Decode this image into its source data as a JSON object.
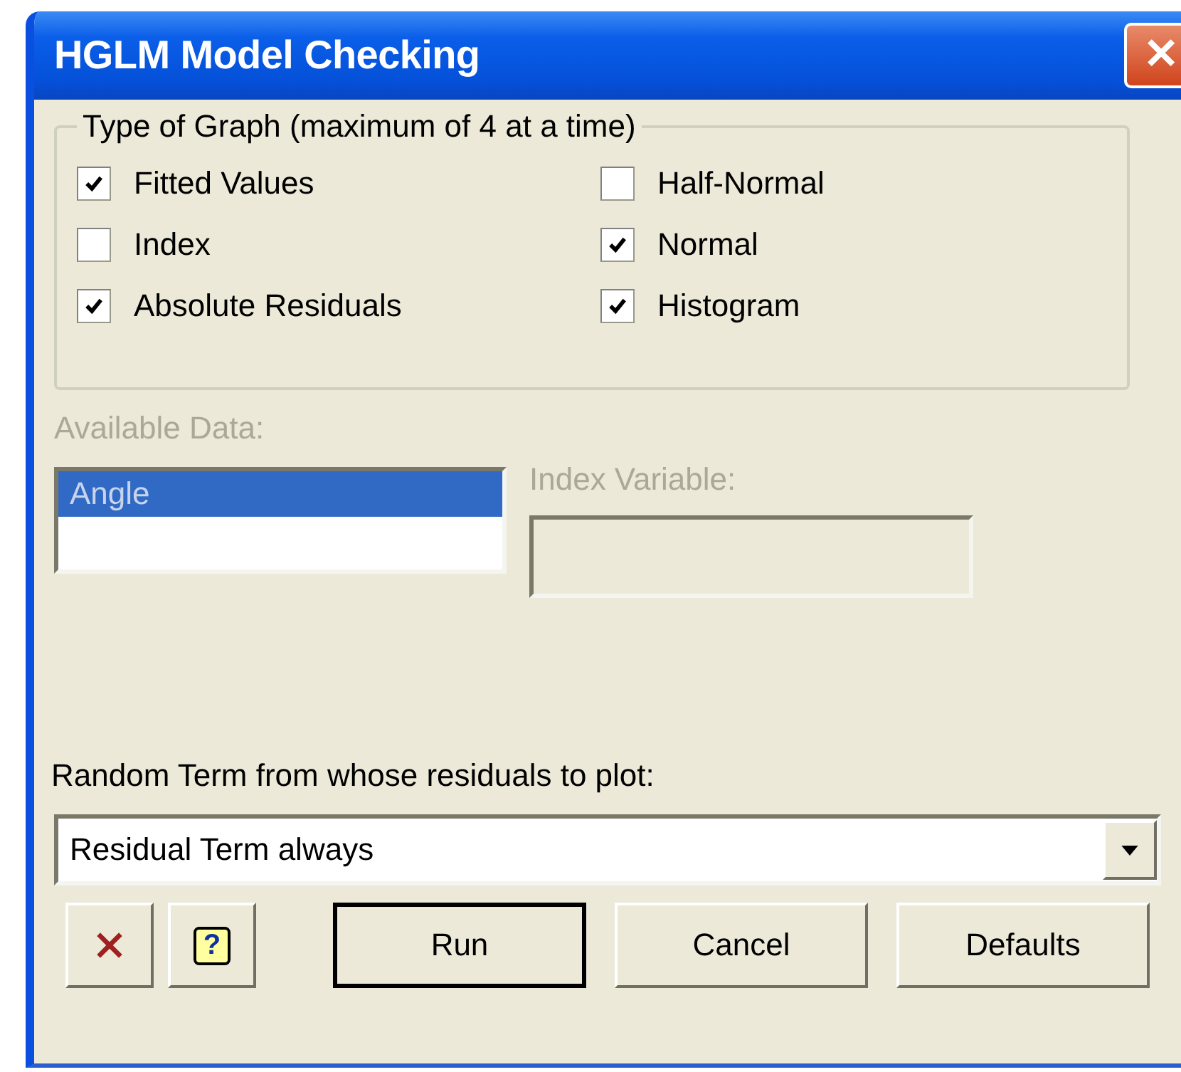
{
  "window": {
    "title": "HGLM Model Checking",
    "close_label": "✕"
  },
  "graph_types": {
    "legend": "Type of Graph (maximum of 4 at a time)",
    "options": [
      {
        "label": "Fitted Values",
        "checked": true
      },
      {
        "label": "Half-Normal",
        "checked": false
      },
      {
        "label": "Index",
        "checked": false
      },
      {
        "label": "Normal",
        "checked": true
      },
      {
        "label": "Absolute Residuals",
        "checked": true
      },
      {
        "label": "Histogram",
        "checked": true
      }
    ]
  },
  "available_data": {
    "label": "Available Data:",
    "disabled": true,
    "items": [
      {
        "label": "Angle",
        "selected": true
      }
    ]
  },
  "index_variable": {
    "label": "Index Variable:",
    "disabled": true
  },
  "random_term": {
    "label": "Random Term from whose residuals to plot:",
    "value": "Residual Term always"
  },
  "buttons": [
    {
      "kind": "close"
    },
    {
      "kind": "help",
      "label": "?"
    },
    {
      "kind": "default",
      "label": "Run"
    },
    {
      "kind": "normal",
      "label": "Cancel"
    },
    {
      "kind": "normal",
      "label": "Defaults"
    }
  ]
}
